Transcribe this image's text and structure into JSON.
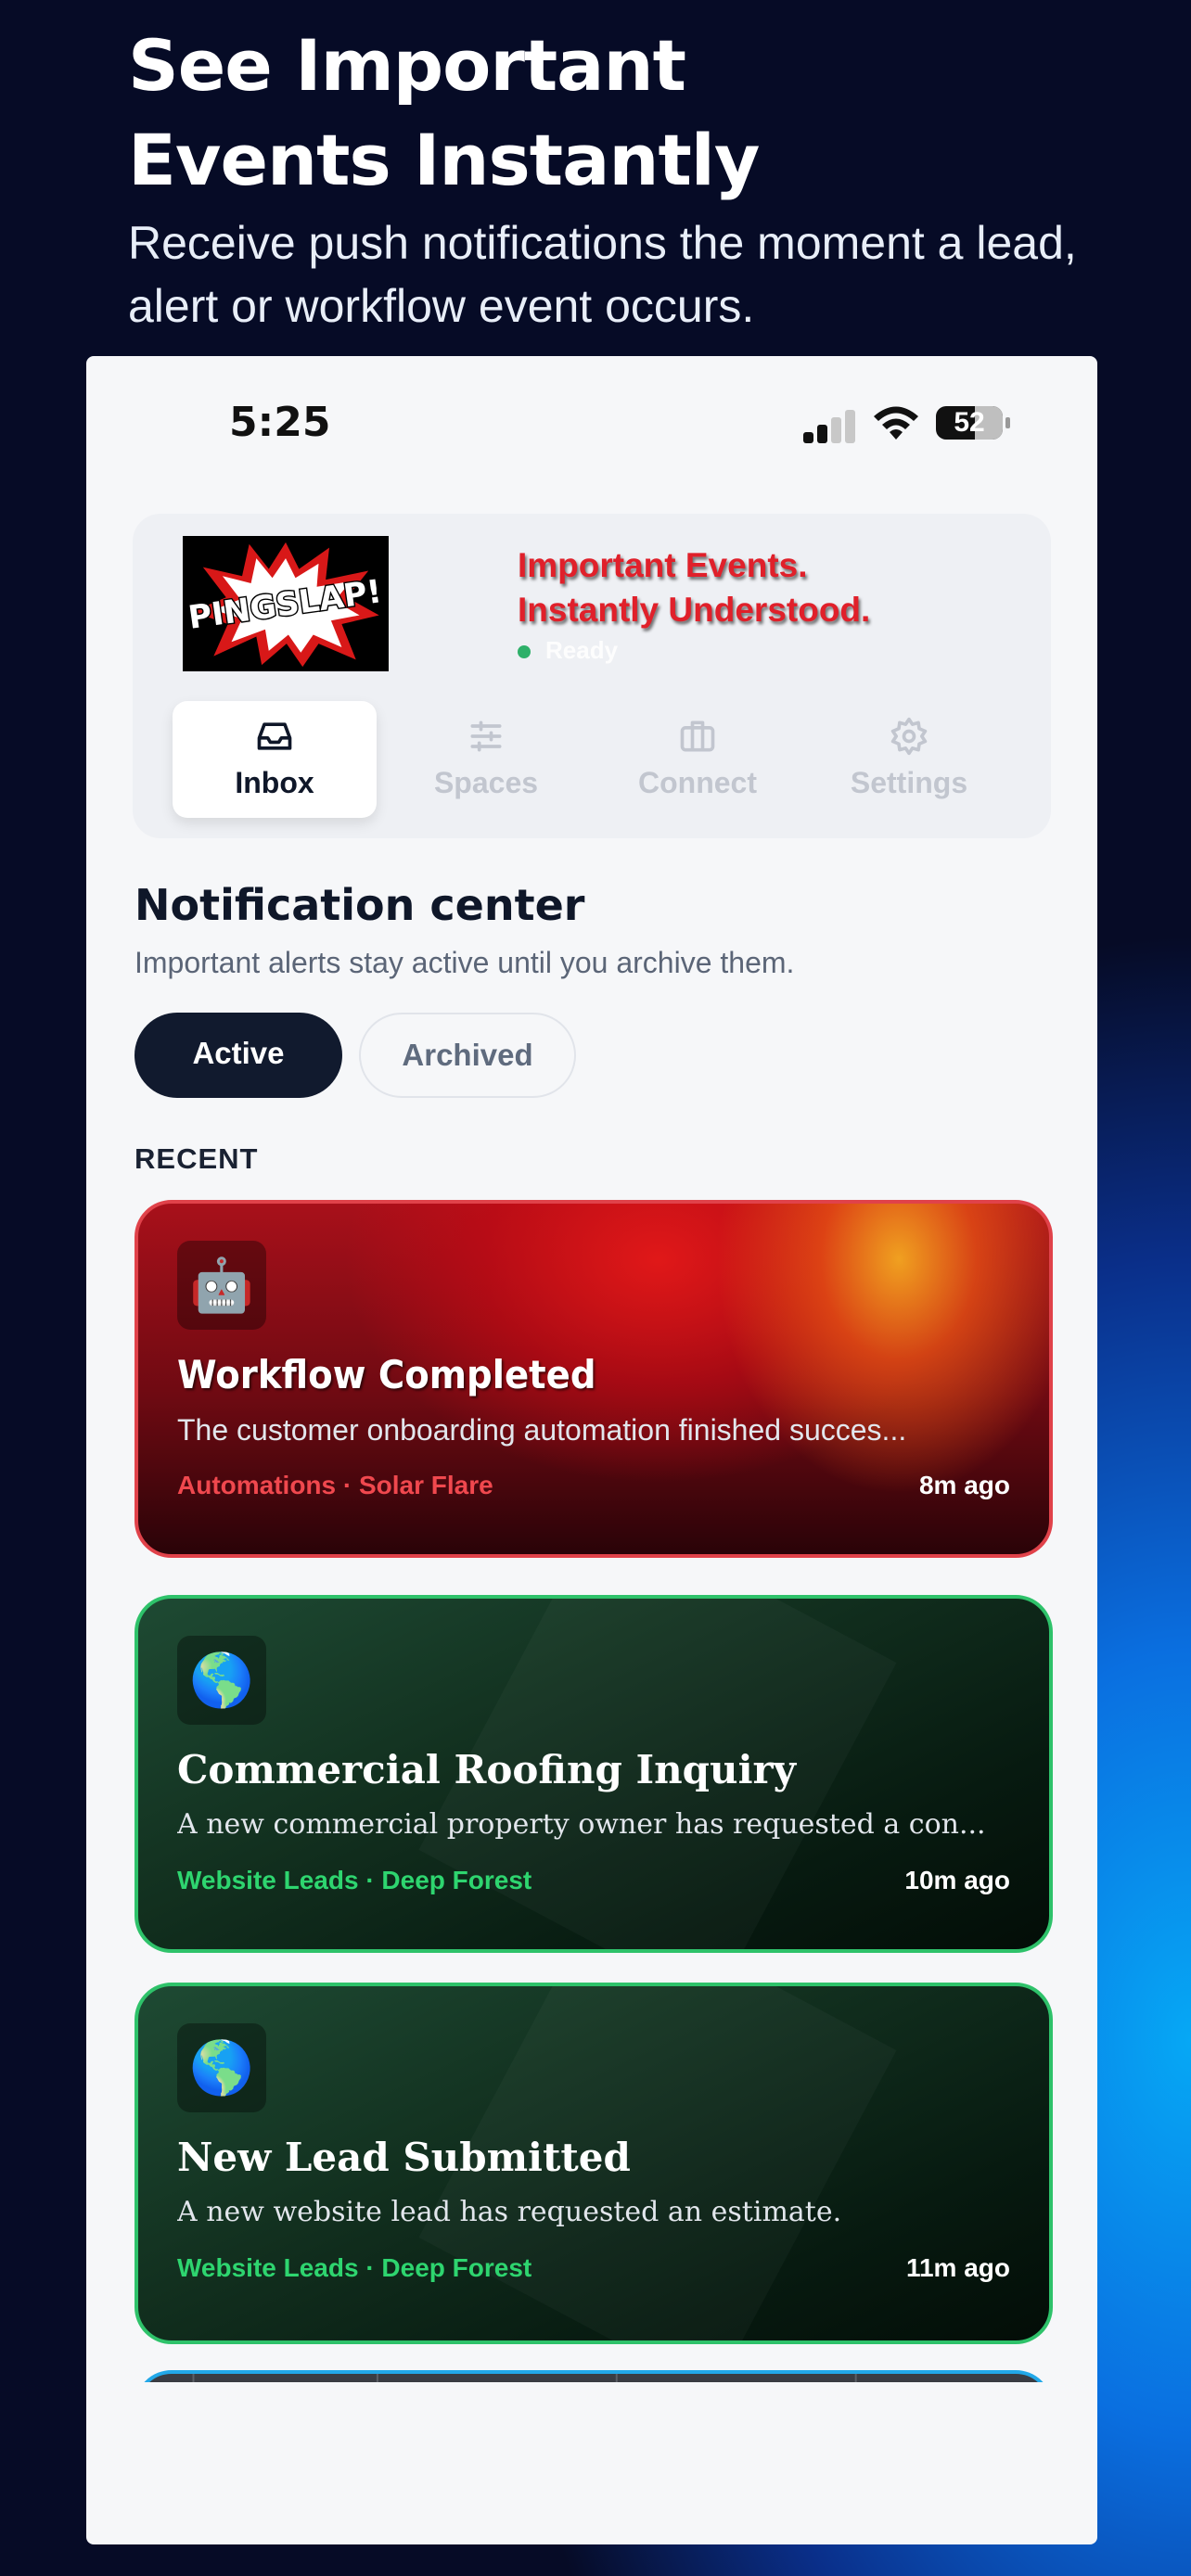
{
  "promo": {
    "title": "See Important\nEvents Instantly",
    "subtitle": "Receive push notifications the moment a lead, alert or workflow event occurs."
  },
  "status_bar": {
    "time": "5:25",
    "battery": "52"
  },
  "header": {
    "logo_text": "PINGSLAP!",
    "tagline": "Important Events.\nInstantly Understood.",
    "status": "Ready"
  },
  "tabs": [
    {
      "label": "Inbox",
      "icon": "inbox-icon",
      "active": true
    },
    {
      "label": "Spaces",
      "icon": "sliders-icon",
      "active": false
    },
    {
      "label": "Connect",
      "icon": "briefcase-icon",
      "active": false
    },
    {
      "label": "Settings",
      "icon": "gear-icon",
      "active": false
    }
  ],
  "notification_center": {
    "title": "Notification center",
    "subtitle": "Important alerts stay active until you archive them.",
    "filters": {
      "active": "Active",
      "archived": "Archived"
    },
    "section_label": "RECENT"
  },
  "notifications": [
    {
      "icon": "🤖",
      "title": "Workflow Completed",
      "body": "The customer onboarding automation finished succes...",
      "meta": "Automations · Solar Flare",
      "time": "8m ago",
      "theme_color": "#e0424a"
    },
    {
      "icon": "🌎",
      "title": "Commercial Roofing Inquiry",
      "body": "A new commercial property owner has requested a con...",
      "meta": "Website Leads · Deep Forest",
      "time": "10m ago",
      "theme_color": "#2ec26a"
    },
    {
      "icon": "🌎",
      "title": "New Lead Submitted",
      "body": "A new website lead has requested an estimate.",
      "meta": "Website Leads · Deep Forest",
      "time": "11m ago",
      "theme_color": "#2ec26a"
    }
  ]
}
